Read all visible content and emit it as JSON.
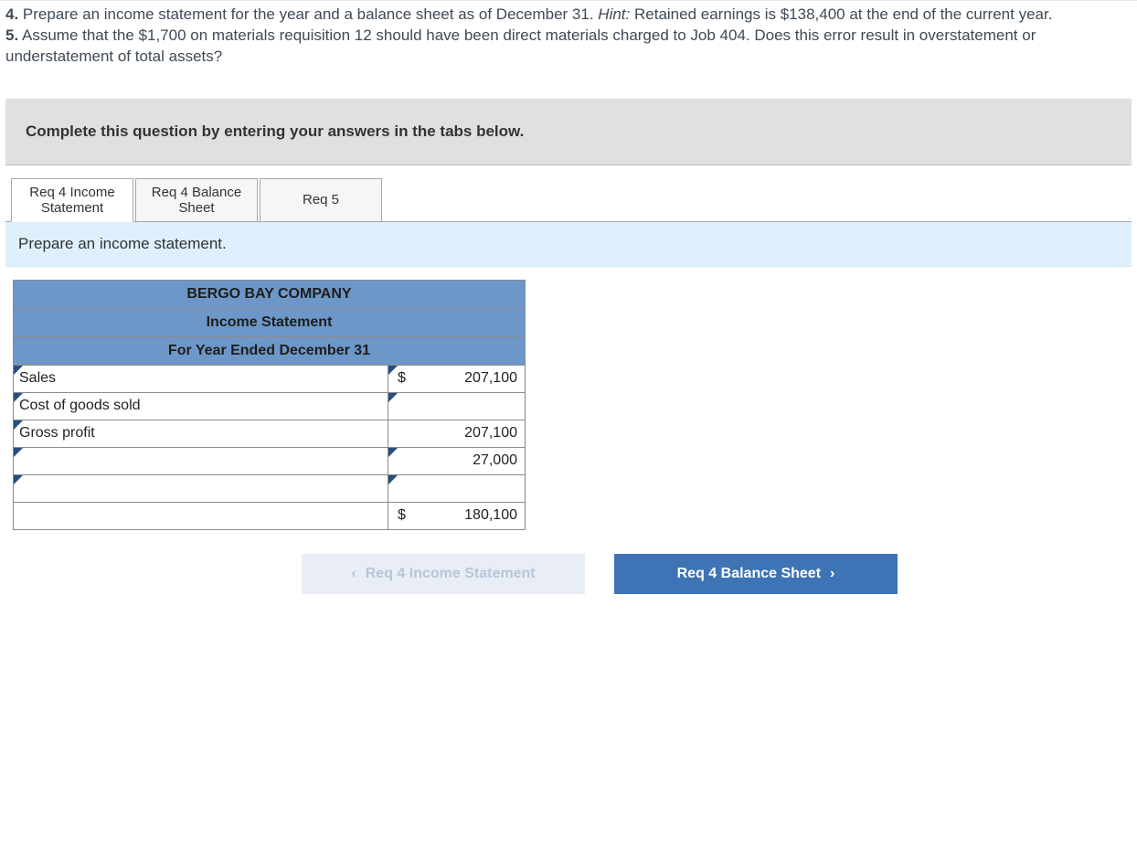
{
  "question": {
    "item4_num": "4.",
    "item4_text_a": "Prepare an income statement for the year and a balance sheet as of December 31. ",
    "item4_hint_label": "Hint:",
    "item4_text_b": " Retained earnings is $138,400 at the end of the current year.",
    "item5_num": "5.",
    "item5_text": "Assume that the $1,700 on materials requisition 12 should have been direct materials charged to Job 404. Does this error result in overstatement or understatement of total assets?"
  },
  "instruction": "Complete this question by entering your answers in the tabs below.",
  "tabs": [
    {
      "line1": "Req 4 Income",
      "line2": "Statement"
    },
    {
      "line1": "Req 4 Balance",
      "line2": "Sheet"
    },
    {
      "line1": "Req 5",
      "line2": ""
    }
  ],
  "panel_prompt": "Prepare an income statement.",
  "statement": {
    "company": "BERGO BAY COMPANY",
    "title": "Income Statement",
    "period": "For Year Ended December 31",
    "rows": [
      {
        "label": "Sales",
        "amount": "207,100",
        "dollar": "$"
      },
      {
        "label": "Cost of goods sold",
        "amount": "",
        "dollar": ""
      },
      {
        "label": "Gross profit",
        "amount": "207,100",
        "dollar": ""
      },
      {
        "label": "",
        "amount": "27,000",
        "dollar": ""
      },
      {
        "label": "",
        "amount": "",
        "dollar": ""
      },
      {
        "label": "",
        "amount": "180,100",
        "dollar": "$"
      }
    ]
  },
  "nav": {
    "prev": "Req 4 Income Statement",
    "next": "Req 4 Balance Sheet"
  }
}
